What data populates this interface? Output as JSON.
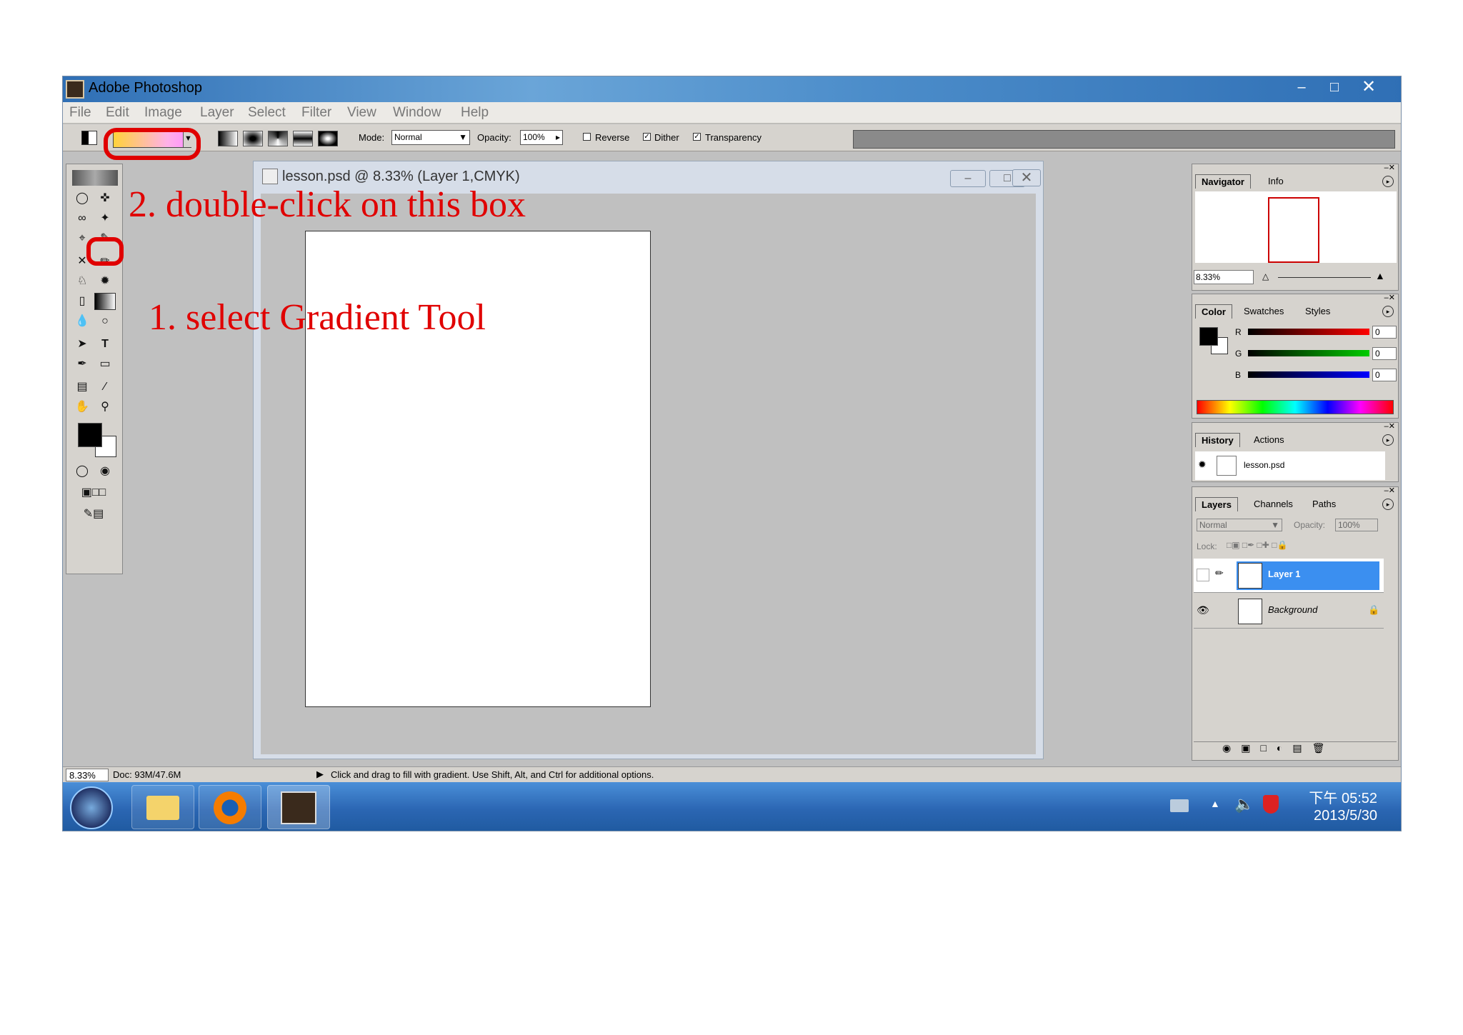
{
  "window": {
    "title": "Adobe Photoshop"
  },
  "menu": [
    "File",
    "Edit",
    "Image",
    "Layer",
    "Select",
    "Filter",
    "View",
    "Window",
    "Help"
  ],
  "options": {
    "mode_label": "Mode:",
    "mode_value": "Normal",
    "opacity_label": "Opacity:",
    "opacity_value": "100%",
    "reverse": "Reverse",
    "dither": "Dither",
    "transparency": "Transparency",
    "gradient_colors": [
      "#ffd23a",
      "#ffb0e8",
      "#ff90ff"
    ]
  },
  "document": {
    "title": "lesson.psd @ 8.33% (Layer 1,CMYK)"
  },
  "annotations": {
    "step2": "2. double-click on this box",
    "step1": "1. select Gradient Tool"
  },
  "navigator": {
    "tabs": [
      "Navigator",
      "Info"
    ],
    "zoom": "8.33%"
  },
  "color": {
    "tabs": [
      "Color",
      "Swatches",
      "Styles"
    ],
    "channels": [
      {
        "name": "R",
        "value": "0"
      },
      {
        "name": "G",
        "value": "0"
      },
      {
        "name": "B",
        "value": "0"
      }
    ]
  },
  "history": {
    "tabs": [
      "History",
      "Actions"
    ],
    "item": "lesson.psd"
  },
  "layers": {
    "tabs": [
      "Layers",
      "Channels",
      "Paths"
    ],
    "blend": "Normal",
    "opacity_label": "Opacity:",
    "opacity_value": "100%",
    "lock_label": "Lock:",
    "items": [
      "Layer 1",
      "Background"
    ]
  },
  "status": {
    "zoom": "8.33%",
    "doc": "Doc: 93M/47.6M",
    "hint": "Click and drag to fill with gradient.  Use Shift, Alt, and Ctrl for additional options."
  },
  "taskbar": {
    "time": "下午 05:52",
    "date": "2013/5/30"
  },
  "accent": "#e00000"
}
